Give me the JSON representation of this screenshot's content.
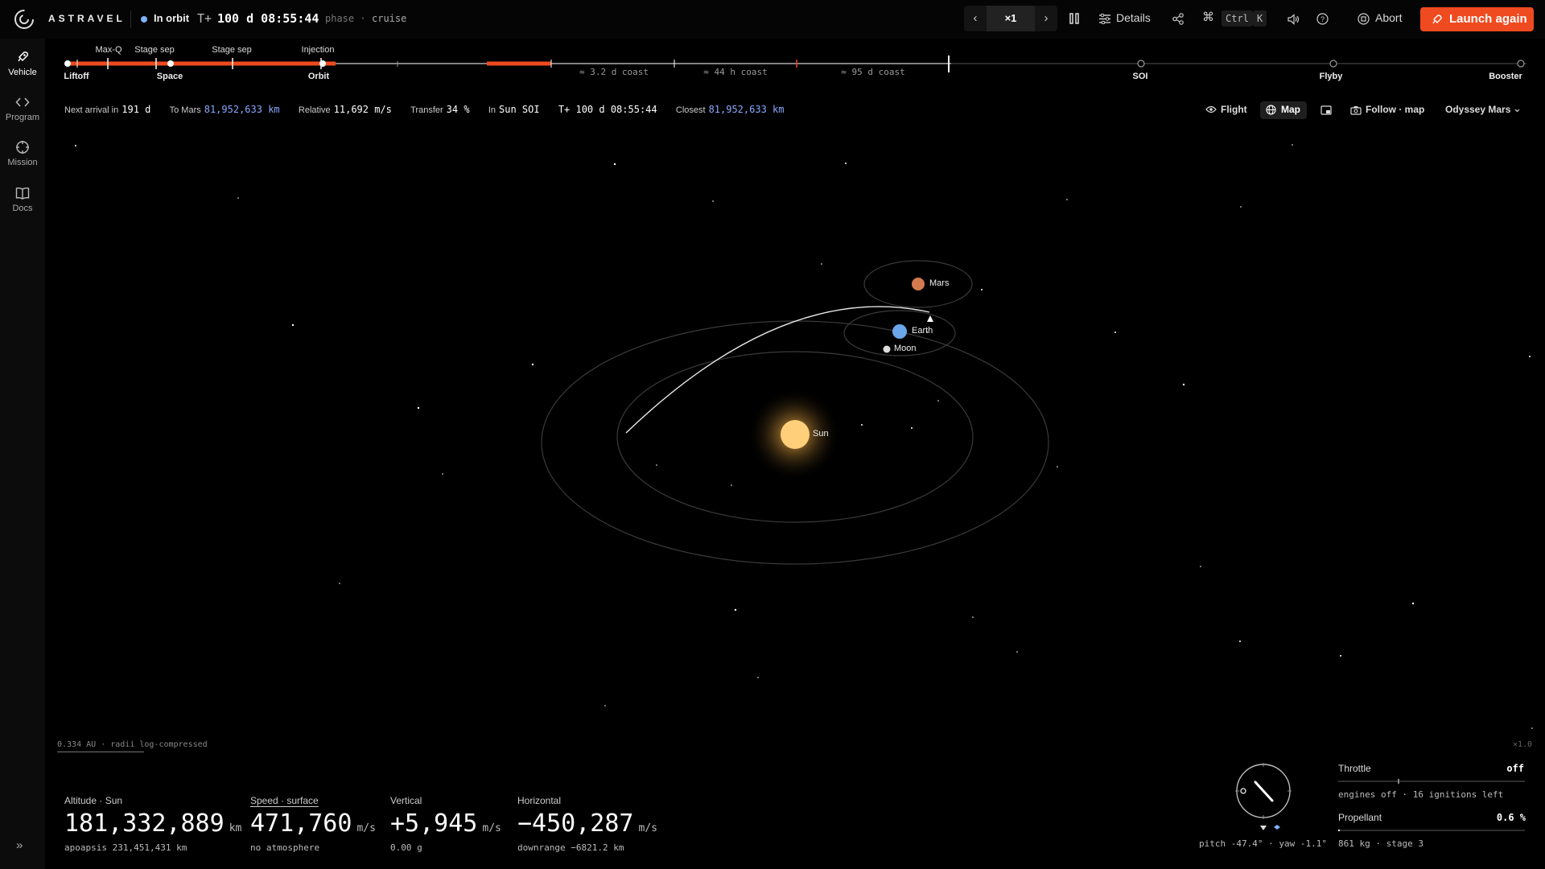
{
  "app": {
    "name": "ASTRAVEL"
  },
  "status": {
    "label": "In orbit",
    "t_prefix": "T+",
    "time": "100 d 08:55:44",
    "phase_label": "phase",
    "phase_sep": "·",
    "phase_value": "cruise"
  },
  "toolbar": {
    "speed": "×1",
    "details_label": "Details",
    "shortcut_keys": [
      "Ctrl",
      "K"
    ],
    "abort_label": "Abort",
    "launch_label": "Launch again",
    "accent_color": "#f04a20"
  },
  "sidebar": {
    "items": [
      {
        "label": "Vehicle",
        "icon": "rocket-icon",
        "active": true
      },
      {
        "label": "Program",
        "icon": "code-icon",
        "active": false
      },
      {
        "label": "Mission",
        "icon": "crosshair-icon",
        "active": false
      },
      {
        "label": "Docs",
        "icon": "book-icon",
        "active": false
      }
    ]
  },
  "timeline": {
    "top_events": [
      "Max-Q",
      "Stage sep",
      "Stage sep",
      "Injection"
    ],
    "bottom_events": [
      "Liftoff",
      "Space",
      "Orbit",
      "SOI",
      "Flyby",
      "Booster"
    ],
    "coasts": [
      "≈ 3.2 d coast",
      "≈ 44 h coast",
      "≈ 95 d coast"
    ]
  },
  "info": {
    "next_arrival_label": "Next arrival in",
    "next_arrival_value": "191 d",
    "to_label": "To Mars",
    "to_value": "81,952,633 km",
    "relative_label": "Relative",
    "relative_value": "11,692 m/s",
    "transfer_label": "Transfer",
    "transfer_value": "34 %",
    "in_label": "In",
    "in_value": "Sun SOI",
    "t_value": "T+ 100 d 08:55:44",
    "closest_label": "Closest",
    "closest_value": "81,952,633 km"
  },
  "view": {
    "flight_label": "Flight",
    "map_label": "Map",
    "follow_label": "Follow · map",
    "mission_name": "Odyssey Mars"
  },
  "map": {
    "bodies": {
      "mars": "Mars",
      "earth": "Earth",
      "moon": "Moon",
      "sun": "Sun"
    },
    "scale_text": "0.334 AU",
    "scale_note": "radii log-compressed",
    "zoom": "×1.0"
  },
  "telemetry": {
    "altitude": {
      "label": "Altitude · Sun",
      "value": "181,332,889",
      "unit": "km",
      "sub": "apoapsis 231,451,431 km"
    },
    "speed": {
      "label": "Speed · surface",
      "value": "471,760",
      "unit": "m/s",
      "sub": "no atmosphere"
    },
    "vertical": {
      "label": "Vertical",
      "value": "+5,945",
      "unit": "m/s",
      "sub": "0.00 g"
    },
    "horizontal": {
      "label": "Horizontal",
      "value": "−450,287",
      "unit": "m/s",
      "sub": "downrange −6821.2 km"
    }
  },
  "attitude": {
    "readout": "pitch -47.4° · yaw -1.1°"
  },
  "engine": {
    "throttle_label": "Throttle",
    "throttle_value": "off",
    "ignitions": "engines off · 16 ignitions left",
    "propellant_label": "Propellant",
    "propellant_value": "0.6 %",
    "propellant_fraction": 0.006,
    "mass_stage": "861 kg · stage 3"
  }
}
